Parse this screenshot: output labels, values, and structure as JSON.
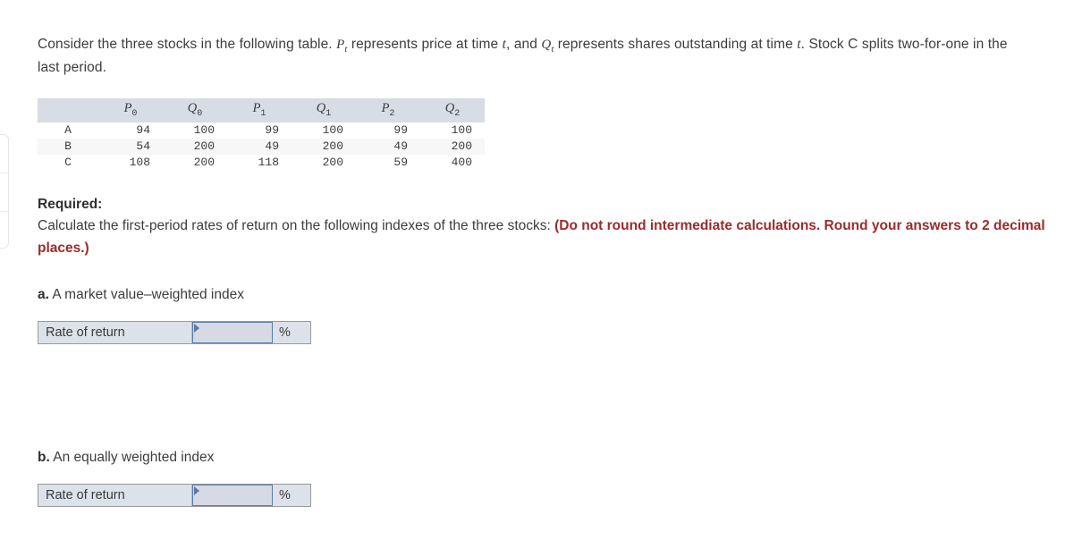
{
  "question": {
    "prompt_part1": "Consider the three stocks in the following table. ",
    "var_p": "P",
    "var_p_sub": "t",
    "prompt_part2": " represents price at time ",
    "var_t1": "t",
    "prompt_part3": ", and ",
    "var_q": "Q",
    "var_q_sub": "t",
    "prompt_part4": " represents shares outstanding at time ",
    "var_t2": "t",
    "prompt_part5": ". Stock C splits two-for-one in the last period."
  },
  "table": {
    "corner": "",
    "columns": [
      {
        "base": "P",
        "sub": "0"
      },
      {
        "base": "Q",
        "sub": "0"
      },
      {
        "base": "P",
        "sub": "1"
      },
      {
        "base": "Q",
        "sub": "1"
      },
      {
        "base": "P",
        "sub": "2"
      },
      {
        "base": "Q",
        "sub": "2"
      }
    ],
    "rows": [
      {
        "label": "A",
        "values": [
          "94",
          "100",
          "99",
          "100",
          "99",
          "100"
        ]
      },
      {
        "label": "B",
        "values": [
          "54",
          "200",
          "49",
          "200",
          "49",
          "200"
        ]
      },
      {
        "label": "C",
        "values": [
          "108",
          "200",
          "118",
          "200",
          "59",
          "400"
        ]
      }
    ]
  },
  "required": {
    "label": "Required:",
    "text": "Calculate the first-period rates of return on the following indexes of the three stocks: ",
    "note": "(Do not round intermediate calculations. Round your answers to 2 decimal places.)"
  },
  "parts": [
    {
      "letter": "a.",
      "title": "A market value–weighted index",
      "answer_label": "Rate of return",
      "answer_value": "",
      "answer_placeholder": "",
      "unit": "%"
    },
    {
      "letter": "b.",
      "letter_b": "b.",
      "title": "An equally weighted index",
      "answer_label": "Rate of return",
      "answer_value": "",
      "answer_placeholder": "",
      "unit": "%"
    }
  ],
  "colors": {
    "table_header_bg": "#d8dce4",
    "table_alt_row_bg": "#f7f7f7",
    "note_red": "#9c2b2b",
    "answer_bg": "#dde1e9",
    "input_border": "#5b7ba8",
    "caret": "#5878a8"
  }
}
